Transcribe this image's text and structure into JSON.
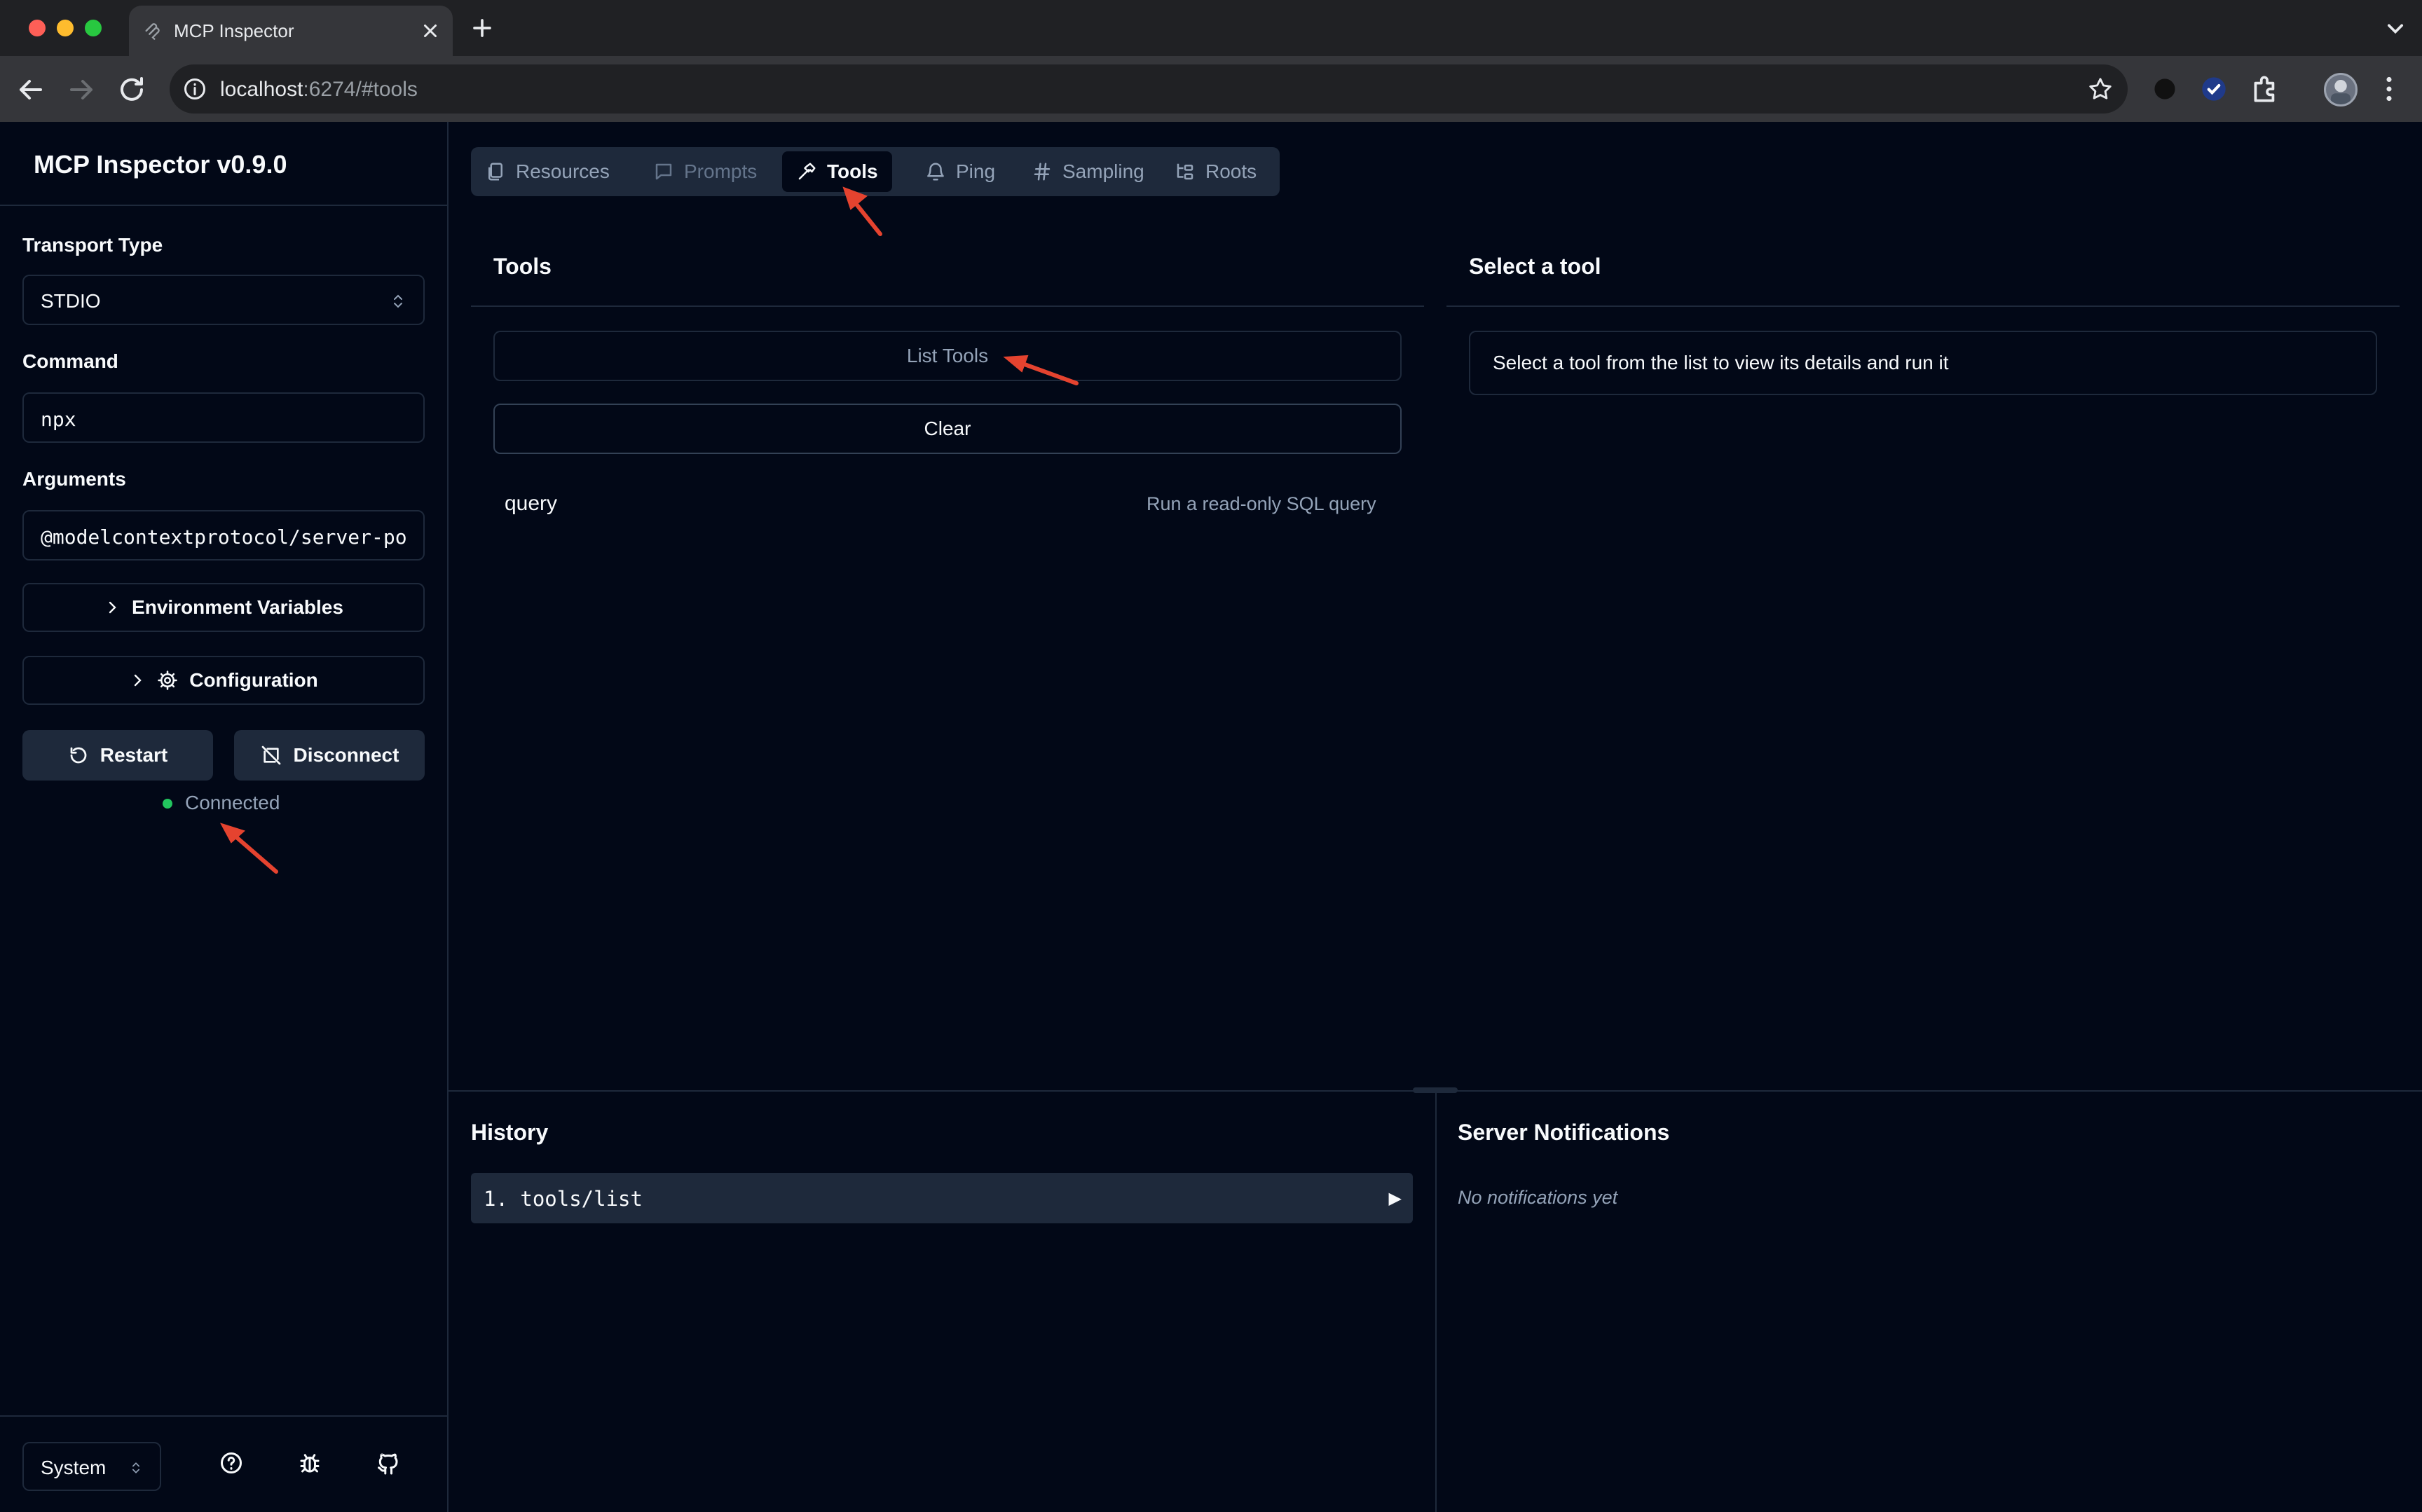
{
  "browser": {
    "tab_title": "MCP Inspector",
    "url_host": "localhost",
    "url_rest": ":6274/#tools"
  },
  "sidebar": {
    "title": "MCP Inspector v0.9.0",
    "transport_label": "Transport Type",
    "transport_value": "STDIO",
    "command_label": "Command",
    "command_value": "npx",
    "arguments_label": "Arguments",
    "arguments_value": "@modelcontextprotocol/server-po",
    "env_button": "Environment Variables",
    "config_button": "Configuration",
    "restart_button": "Restart",
    "disconnect_button": "Disconnect",
    "status": "Connected",
    "status_color": "#22c55e",
    "theme_value": "System"
  },
  "tabs": [
    {
      "label": "Resources",
      "icon": "files-icon"
    },
    {
      "label": "Prompts",
      "icon": "message-square-icon"
    },
    {
      "label": "Tools",
      "icon": "hammer-icon"
    },
    {
      "label": "Ping",
      "icon": "bell-icon"
    },
    {
      "label": "Sampling",
      "icon": "hash-icon"
    },
    {
      "label": "Roots",
      "icon": "folder-tree-icon"
    }
  ],
  "tools_panel": {
    "title": "Tools",
    "list_button": "List Tools",
    "clear_button": "Clear",
    "tools": [
      {
        "name": "query",
        "description": "Run a read-only SQL query"
      }
    ]
  },
  "detail_panel": {
    "title": "Select a tool",
    "message": "Select a tool from the list to view its details and run it"
  },
  "history": {
    "title": "History",
    "items": [
      {
        "label": "1. tools/list"
      }
    ]
  },
  "notifications": {
    "title": "Server Notifications",
    "empty": "No notifications yet"
  },
  "colors": {
    "background": "#020817",
    "border": "#1e293b",
    "muted_text": "#94a3b8",
    "annotation_arrow": "#e5432f"
  }
}
